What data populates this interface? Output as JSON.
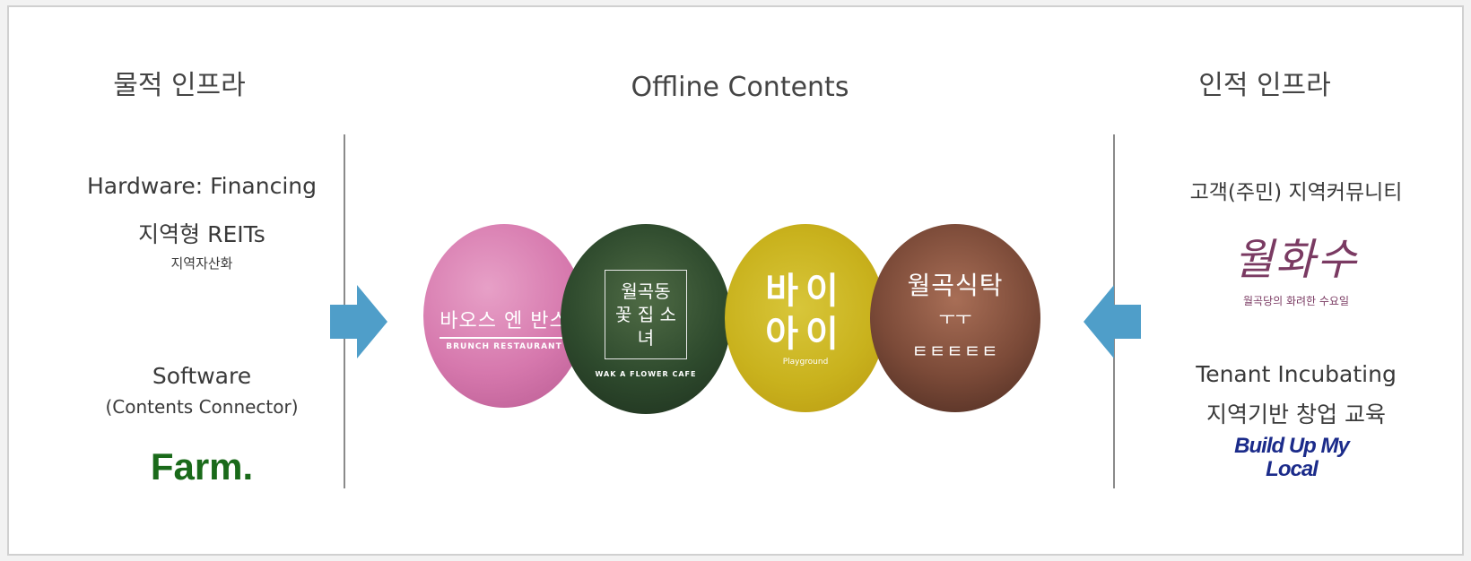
{
  "headers": {
    "left": "물적 인프라",
    "center": "Offline Contents",
    "right": "인적 인프라"
  },
  "left": {
    "hardware": "Hardware: Financing",
    "reits": "지역형 REITs",
    "reits_sub": "지역자산화",
    "software": "Software",
    "software_sub": "(Contents Connector)",
    "logo": "Farm."
  },
  "right": {
    "community": "고객(주민) 지역커뮤니티",
    "logo_main": "월화수",
    "logo_sub": "월곡당의 화려한 수요일",
    "incubating": "Tenant Incubating",
    "incubating_sub": "지역기반 창업 교육",
    "buildup": "Build Up My Local"
  },
  "circles": [
    {
      "main": "바오스 엔 반스",
      "sub": "BRUNCH RESTAURANT"
    },
    {
      "main": "월곡동 꽃 집 소녀",
      "sub": "WAK A FLOWER CAFE"
    },
    {
      "main_line1": "바이",
      "main_line2": "아이",
      "sub": "Playground"
    },
    {
      "main": "월곡식탁",
      "mid": "ㅜㅜ",
      "sub": "ㅌㅌㅌㅌㅌ"
    }
  ],
  "colors": {
    "arrow": "#4f9ec9",
    "farm": "#1a6a1a",
    "buildup": "#1b2b8a",
    "wolhwa": "#7a3a62"
  }
}
